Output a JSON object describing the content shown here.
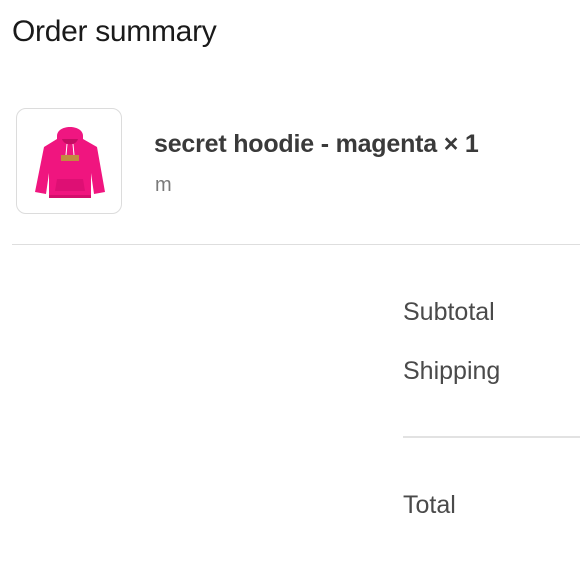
{
  "summary": {
    "heading": "Order summary"
  },
  "line_item": {
    "title": "secret hoodie - magenta × 1",
    "variant": "m",
    "image_icon": "hoodie-product-image",
    "product_color": "#f0157f"
  },
  "costs": {
    "subtotal_label": "Subtotal",
    "shipping_label": "Shipping",
    "total_label": "Total"
  }
}
